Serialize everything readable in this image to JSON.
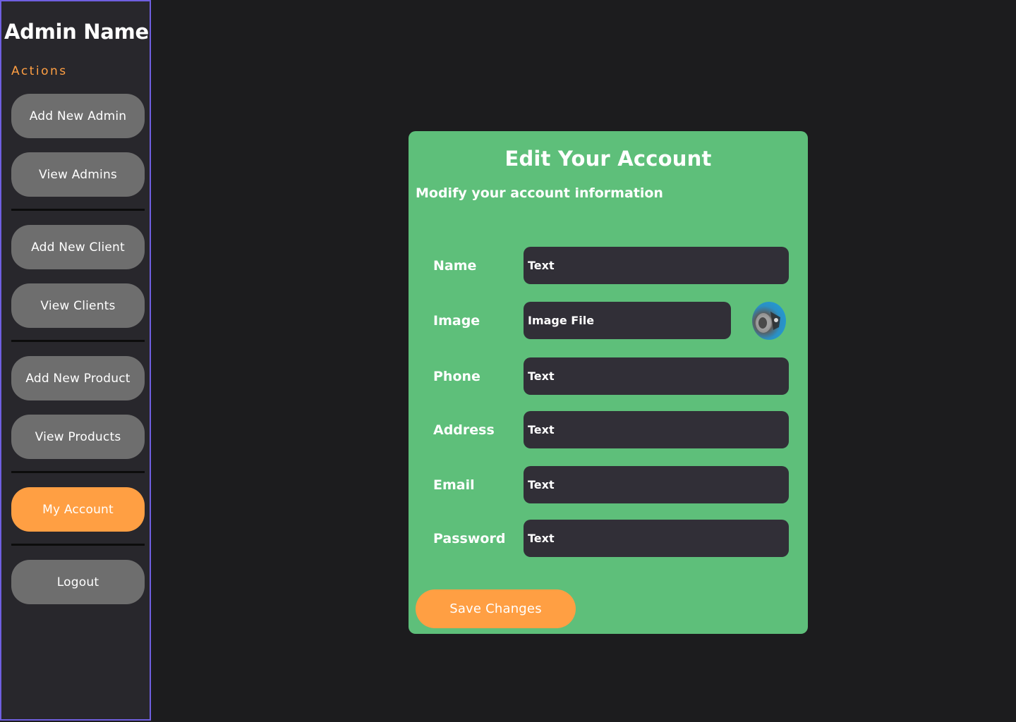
{
  "sidebar": {
    "admin_name": "Admin Name",
    "section_label": "Actions",
    "items": [
      {
        "label": "Add New Admin"
      },
      {
        "label": "View Admins"
      },
      {
        "label": "Add New Client"
      },
      {
        "label": "View Clients"
      },
      {
        "label": "Add New Product"
      },
      {
        "label": "View Products"
      },
      {
        "label": "My Account",
        "active": true
      },
      {
        "label": "Logout"
      }
    ]
  },
  "form": {
    "title": "Edit Your Account",
    "subtitle": "Modify your account information",
    "fields": [
      {
        "label": "Name",
        "value": "Text"
      },
      {
        "label": "Image",
        "value": "Image File"
      },
      {
        "label": "Phone",
        "value": "Text"
      },
      {
        "label": "Address",
        "value": "Text"
      },
      {
        "label": "Email",
        "value": "Text"
      },
      {
        "label": "Password",
        "value": "Text"
      }
    ],
    "avatar_icon": "profile-image-thumbnail",
    "save_label": "Save Changes"
  },
  "colors": {
    "background": "#1c1c1e",
    "sidebar": "#28272c",
    "sidebar_border": "#6f5fe0",
    "accent": "#ff9f43",
    "nav_button": "#6e6e6e",
    "card": "#5ebf7a",
    "input": "#312f37"
  }
}
